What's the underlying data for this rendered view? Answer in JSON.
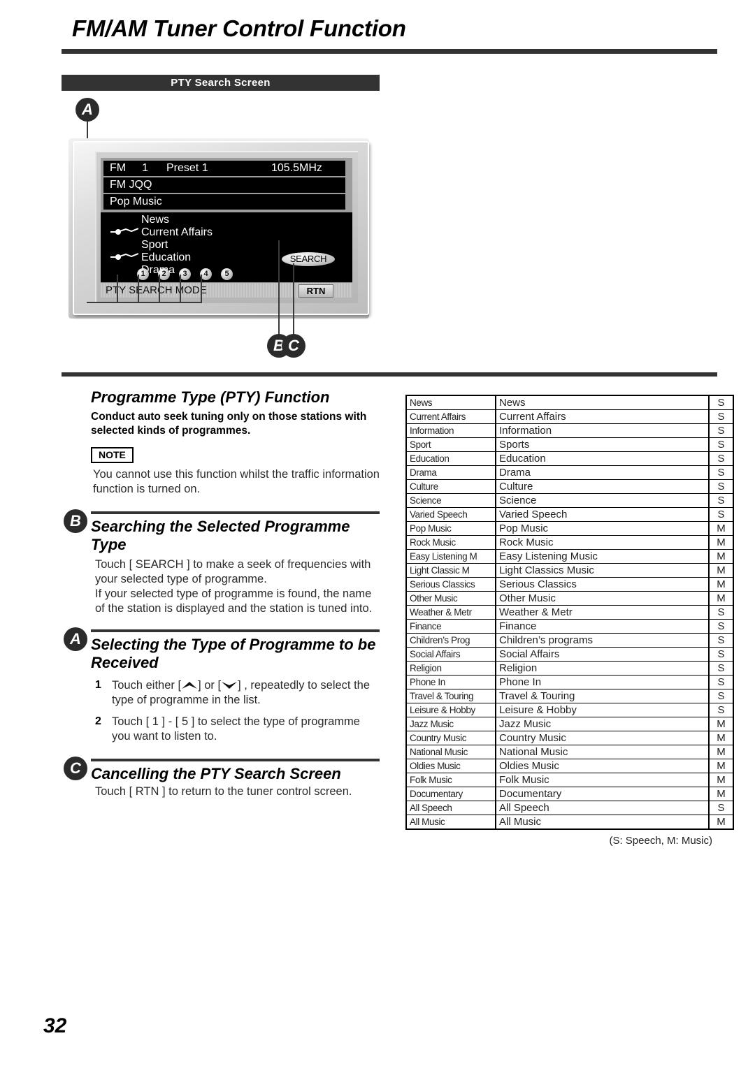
{
  "page": {
    "title": "FM/AM Tuner Control Function",
    "number": "32",
    "section_banner": "PTY Search Screen"
  },
  "callouts": {
    "a": "A",
    "b": "B",
    "c": "C"
  },
  "device": {
    "header_rows": [
      {
        "band": "FM",
        "preset_num": "1",
        "preset_label": "Preset 1",
        "frequency": "105.5MHz"
      },
      {
        "text": "FM JQQ"
      },
      {
        "text": "Pop Music"
      }
    ],
    "list_items": [
      "News",
      "Current Affairs",
      "Sport",
      "Education",
      "Drama"
    ],
    "number_buttons": [
      "1",
      "2",
      "3",
      "4",
      "5"
    ],
    "search_button": "SEARCH",
    "mode_label": "PTY SEARCH MODE",
    "rtn_button": "RTN"
  },
  "sections": {
    "pty_function": {
      "heading": "Programme Type (PTY) Function",
      "lead": "Conduct auto seek tuning only on those stations with selected kinds of programmes.",
      "note_label": "NOTE",
      "note_text": "You cannot use this function whilst the traffic information function is turned on."
    },
    "searching": {
      "marker": "B",
      "heading": "Searching the Selected Programme Type",
      "para1": "Touch [ SEARCH ] to make a seek of frequencies with your selected type of programme.",
      "para2": "If your selected type of programme is found, the name of the station is displayed and the station is tuned into."
    },
    "selecting": {
      "marker": "A",
      "heading": "Selecting the Type of Programme to be Received",
      "step1_num": "1",
      "step1_pre": "Touch either [",
      "step1_mid": "] or [",
      "step1_post": "] , repeatedly to select the type of programme in the list.",
      "step2_num": "2",
      "step2_text": "Touch [ 1 ] - [ 5 ] to select the type of programme you want to listen to."
    },
    "cancelling": {
      "marker": "C",
      "heading": "Cancelling the PTY Search Screen",
      "para": "Touch [ RTN ] to return to the tuner control screen."
    }
  },
  "pty_table": {
    "footnote": "(S: Speech, M: Music)",
    "rows": [
      {
        "short": "News",
        "full": "News",
        "kind": "S"
      },
      {
        "short": "Current Affairs",
        "full": "Current Affairs",
        "kind": "S"
      },
      {
        "short": "Information",
        "full": "Information",
        "kind": "S"
      },
      {
        "short": "Sport",
        "full": "Sports",
        "kind": "S"
      },
      {
        "short": "Education",
        "full": "Education",
        "kind": "S"
      },
      {
        "short": "Drama",
        "full": "Drama",
        "kind": "S"
      },
      {
        "short": "Culture",
        "full": "Culture",
        "kind": "S"
      },
      {
        "short": "Science",
        "full": "Science",
        "kind": "S"
      },
      {
        "short": "Varied Speech",
        "full": "Varied Speech",
        "kind": "S"
      },
      {
        "short": "Pop Music",
        "full": "Pop Music",
        "kind": "M"
      },
      {
        "short": "Rock Music",
        "full": "Rock Music",
        "kind": "M"
      },
      {
        "short": "Easy Listening M",
        "full": "Easy Listening Music",
        "kind": "M"
      },
      {
        "short": "Light Classic M",
        "full": "Light Classics Music",
        "kind": "M"
      },
      {
        "short": "Serious Classics",
        "full": "Serious Classics",
        "kind": "M"
      },
      {
        "short": "Other Music",
        "full": "Other Music",
        "kind": "M"
      },
      {
        "short": "Weather & Metr",
        "full": "Weather & Metr",
        "kind": "S"
      },
      {
        "short": "Finance",
        "full": "Finance",
        "kind": "S"
      },
      {
        "short": "Children’s Prog",
        "full": "Children’s programs",
        "kind": "S"
      },
      {
        "short": "Social Affairs",
        "full": "Social Affairs",
        "kind": "S"
      },
      {
        "short": "Religion",
        "full": "Religion",
        "kind": "S"
      },
      {
        "short": "Phone In",
        "full": "Phone In",
        "kind": "S"
      },
      {
        "short": "Travel & Touring",
        "full": "Travel & Touring",
        "kind": "S"
      },
      {
        "short": "Leisure & Hobby",
        "full": "Leisure & Hobby",
        "kind": "S"
      },
      {
        "short": "Jazz Music",
        "full": "Jazz Music",
        "kind": "M"
      },
      {
        "short": "Country Music",
        "full": "Country Music",
        "kind": "M"
      },
      {
        "short": "National Music",
        "full": "National Music",
        "kind": "M"
      },
      {
        "short": "Oldies Music",
        "full": "Oldies Music",
        "kind": "M"
      },
      {
        "short": "Folk Music",
        "full": "Folk Music",
        "kind": "M"
      },
      {
        "short": "Documentary",
        "full": "Documentary",
        "kind": "M"
      },
      {
        "short": "All Speech",
        "full": "All Speech",
        "kind": "S"
      },
      {
        "short": "All Music",
        "full": "All Music",
        "kind": "M"
      }
    ]
  }
}
